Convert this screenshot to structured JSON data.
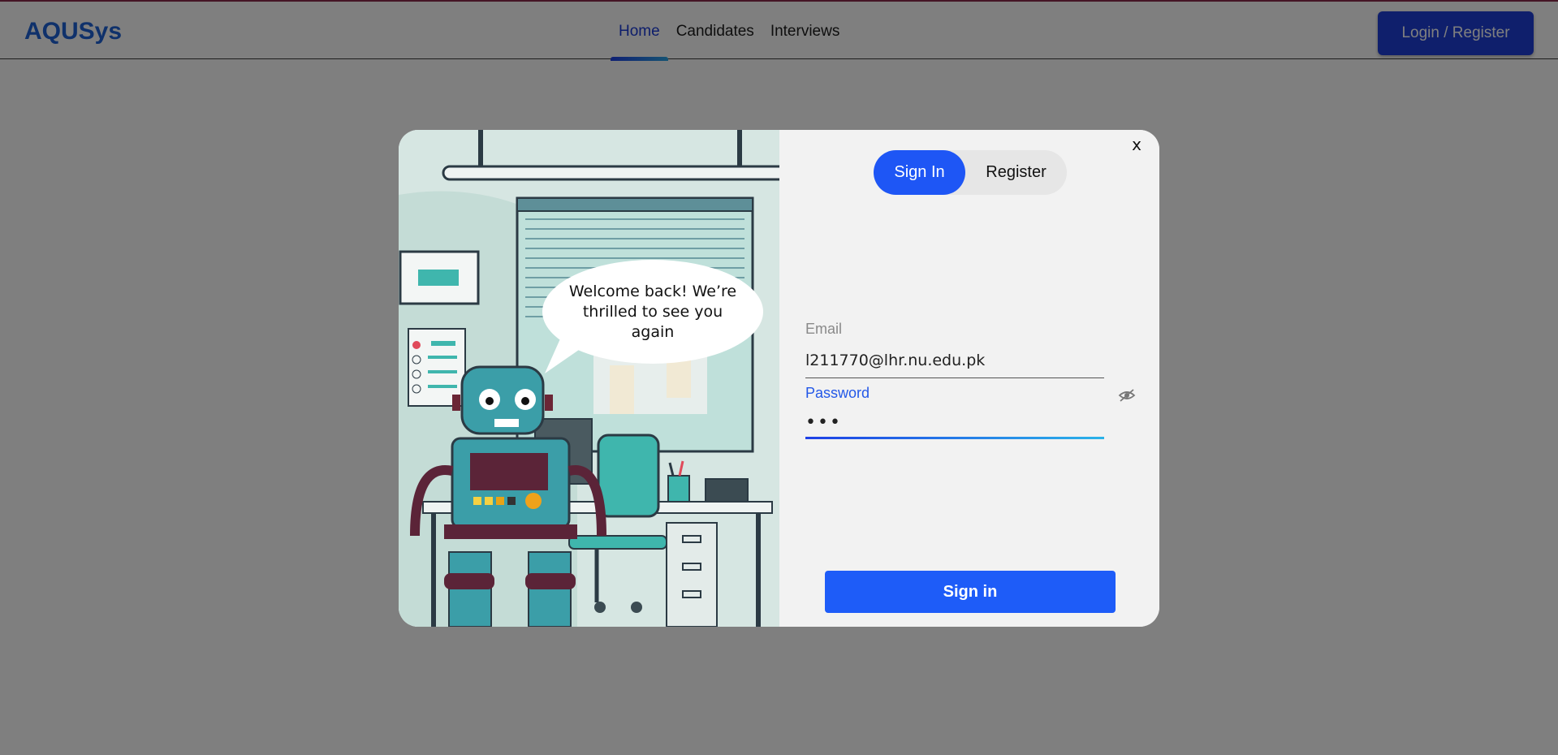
{
  "navbar": {
    "brand": "AQUSys",
    "links": [
      {
        "label": "Home",
        "active": true
      },
      {
        "label": "Candidates",
        "active": false
      },
      {
        "label": "Interviews",
        "active": false
      }
    ],
    "login_label": "Login / Register"
  },
  "modal": {
    "close_label": "x",
    "speech_bubble": "Welcome back! We’re thrilled to see you again",
    "tabs": {
      "sign_in": "Sign In",
      "register": "Register",
      "active": "sign_in"
    },
    "email": {
      "label": "Email",
      "value": "l211770@lhr.nu.edu.pk"
    },
    "password": {
      "label": "Password",
      "value": "•••"
    },
    "submit_label": "Sign in"
  },
  "colors": {
    "brand": "#1e63d6",
    "primary": "#1e5cf8",
    "overlay": "rgba(0,0,0,0.5)"
  }
}
